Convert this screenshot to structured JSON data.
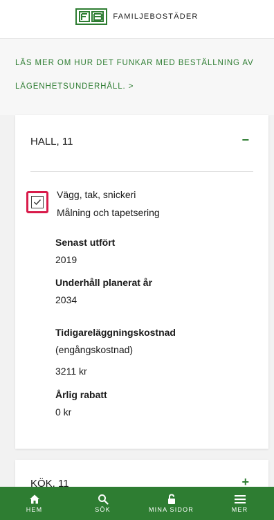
{
  "header": {
    "brand_name": "FAMILJEBOSTÄDER"
  },
  "intro": {
    "info_link": "LÄS MER OM HUR DET FUNKAR MED BESTÄLLNING AV LÄGENHETSUNDERHÅLL. >"
  },
  "cards": [
    {
      "title": "HALL, 11",
      "toggle": "−",
      "expanded": true,
      "checked": true,
      "task_line_1": "Vägg, tak, snickeri",
      "task_line_2": "Målning och tapetsering",
      "last_done_label": "Senast utfört",
      "last_done_value": "2019",
      "planned_label": "Underhåll planerat år",
      "planned_value": "2034",
      "early_cost_label": "Tidigareläggningskostnad",
      "early_cost_note": "(engångskostnad)",
      "early_cost_value": "3211 kr",
      "rebate_label": "Årlig rabatt",
      "rebate_value": "0 kr"
    },
    {
      "title": "KÖK, 11",
      "toggle": "+",
      "expanded": false
    }
  ],
  "bottom_nav": [
    {
      "label": "HEM",
      "icon": "home-icon"
    },
    {
      "label": "SÖK",
      "icon": "search-icon"
    },
    {
      "label": "MINA SIDOR",
      "icon": "lock-icon"
    },
    {
      "label": "MER",
      "icon": "menu-icon"
    }
  ],
  "colors": {
    "brand_green": "#2e7d32",
    "checkbox_highlight": "#d81b4a"
  }
}
